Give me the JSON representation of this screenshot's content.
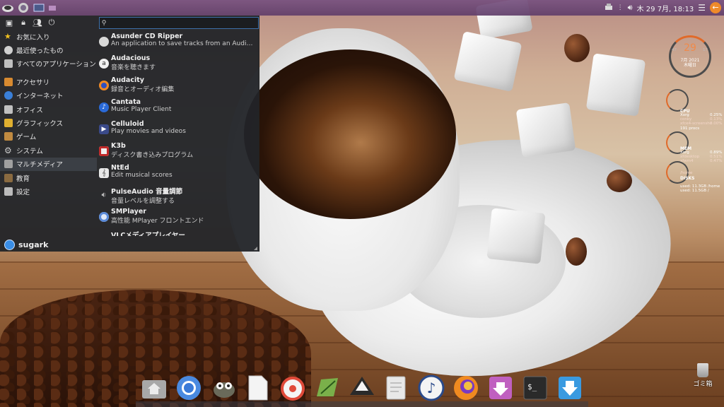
{
  "top_panel": {
    "clock": "木 29 7月, 18:13",
    "icons": [
      "app-menu-icon",
      "whisker-globe-icon",
      "terminal-mini-icon",
      "folder-mini-icon"
    ],
    "tray_icons": [
      "printer-icon",
      "dots-icon",
      "volume-icon",
      "hamburger-icon",
      "logout-icon"
    ]
  },
  "menu": {
    "search": {
      "value": "",
      "placeholder": ""
    },
    "quick_icons": [
      "settings-icon",
      "lock-icon",
      "switch-user-icon",
      "power-icon"
    ],
    "categories": [
      {
        "label": "お気に入り",
        "icon": "star-icon",
        "color": "#f0c020"
      },
      {
        "label": "最近使ったもの",
        "icon": "clock-icon",
        "color": "#d0d0d0"
      },
      {
        "label": "すべてのアプリケーション",
        "icon": "all-apps-icon",
        "color": "#c0c0c0"
      },
      {
        "label": "アクセサリ",
        "icon": "accessories-icon",
        "color": "#d88a30"
      },
      {
        "label": "インターネット",
        "icon": "globe-icon",
        "color": "#3a7fd8"
      },
      {
        "label": "オフィス",
        "icon": "office-icon",
        "color": "#c0c0c0"
      },
      {
        "label": "グラフィックス",
        "icon": "graphics-icon",
        "color": "#e0b030"
      },
      {
        "label": "ゲーム",
        "icon": "game-icon",
        "color": "#c08a40"
      },
      {
        "label": "システム",
        "icon": "system-gear-icon",
        "color": "#c8c8c8"
      },
      {
        "label": "マルチメディア",
        "icon": "multimedia-icon",
        "color": "#a0a0a0"
      },
      {
        "label": "教育",
        "icon": "education-icon",
        "color": "#8a6a40"
      },
      {
        "label": "設定",
        "icon": "settings-panel-icon",
        "color": "#bcbcbc"
      }
    ],
    "selected_category": "マルチメディア",
    "username": "sugark",
    "apps": [
      {
        "name": "Asunder CD Ripper",
        "desc": "An application to save tracks from an Audio CD",
        "icon": "cd-ripper-icon",
        "color": "#d8d8d8"
      },
      {
        "name": "Audacious",
        "desc": "音楽を聴きます",
        "icon": "audacious-icon",
        "color": "#2a2a2a"
      },
      {
        "name": "Audacity",
        "desc": "録音とオーディオ編集",
        "icon": "audacity-icon",
        "color": "#3050c0"
      },
      {
        "name": "Cantata",
        "desc": "Music Player Client",
        "icon": "cantata-icon",
        "color": "#2a6ad8"
      },
      {
        "name": "Celluloid",
        "desc": "Play movies and videos",
        "icon": "celluloid-icon",
        "color": "#3a4a8a"
      },
      {
        "name": "K3b",
        "desc": "ディスク書き込みプログラム",
        "icon": "k3b-icon",
        "color": "#c02a2a"
      },
      {
        "name": "NtEd",
        "desc": "Edit musical scores",
        "icon": "nted-icon",
        "color": "#e8e8e8"
      },
      {
        "name": "PulseAudio 音量調節",
        "desc": "音量レベルを調整する",
        "icon": "speaker-icon",
        "color": "#8a8a8a"
      },
      {
        "name": "SMPlayer",
        "desc": "高性能 MPlayer フロントエンド",
        "icon": "smplayer-icon",
        "color": "#5a8ad8"
      },
      {
        "name": "VLCメディアプレイヤー",
        "desc": "",
        "icon": "vlc-icon",
        "color": "#f08a20"
      }
    ]
  },
  "conky": {
    "day": "29",
    "date": "7月 2021",
    "weekday": "木曜日",
    "ring_side_labels": [
      "47",
      "17"
    ],
    "cpu": {
      "title": "CPU",
      "rows": [
        [
          "Xorg",
          "0.25%"
        ],
        [
          "conky",
          "0.13%"
        ],
        [
          "xfce4-screensho",
          "0.00%"
        ]
      ],
      "procs": "191 procs"
    },
    "mem": {
      "title": "MEM",
      "rows": [
        [
          "Xorg",
          "0.89%"
        ],
        [
          "xfdesktop",
          "0.51%"
        ],
        [
          "xfwm4",
          "0.47%"
        ]
      ]
    },
    "disk": {
      "title": "DISKS",
      "sub": "/home",
      "rows": [
        "used: 11.3GB /home",
        "used: 11.5GB /"
      ]
    }
  },
  "desktop": {
    "trash_label": "ゴミ箱"
  },
  "dock": [
    {
      "name": "home-folder-icon",
      "color": "#9a9a9a"
    },
    {
      "name": "chromium-icon",
      "color": "#4a8ae0"
    },
    {
      "name": "gimp-icon",
      "color": "#6a6a5a"
    },
    {
      "name": "text-file-icon",
      "color": "#f4f4f4"
    },
    {
      "name": "rhythmbox-icon",
      "color": "#e04a3a"
    },
    {
      "name": "leafpad-icon",
      "color": "#7ab04a"
    },
    {
      "name": "inkscape-icon",
      "color": "#2a2a2a"
    },
    {
      "name": "text-editor-icon",
      "color": "#d8d8d8"
    },
    {
      "name": "music-note-icon",
      "color": "#2a4a8a"
    },
    {
      "name": "firefox-icon",
      "color": "#f08a20"
    },
    {
      "name": "installer-icon",
      "color": "#c060c0"
    },
    {
      "name": "terminal-icon",
      "color": "#2a2a2a"
    },
    {
      "name": "download-icon",
      "color": "#3a9ae0"
    }
  ]
}
